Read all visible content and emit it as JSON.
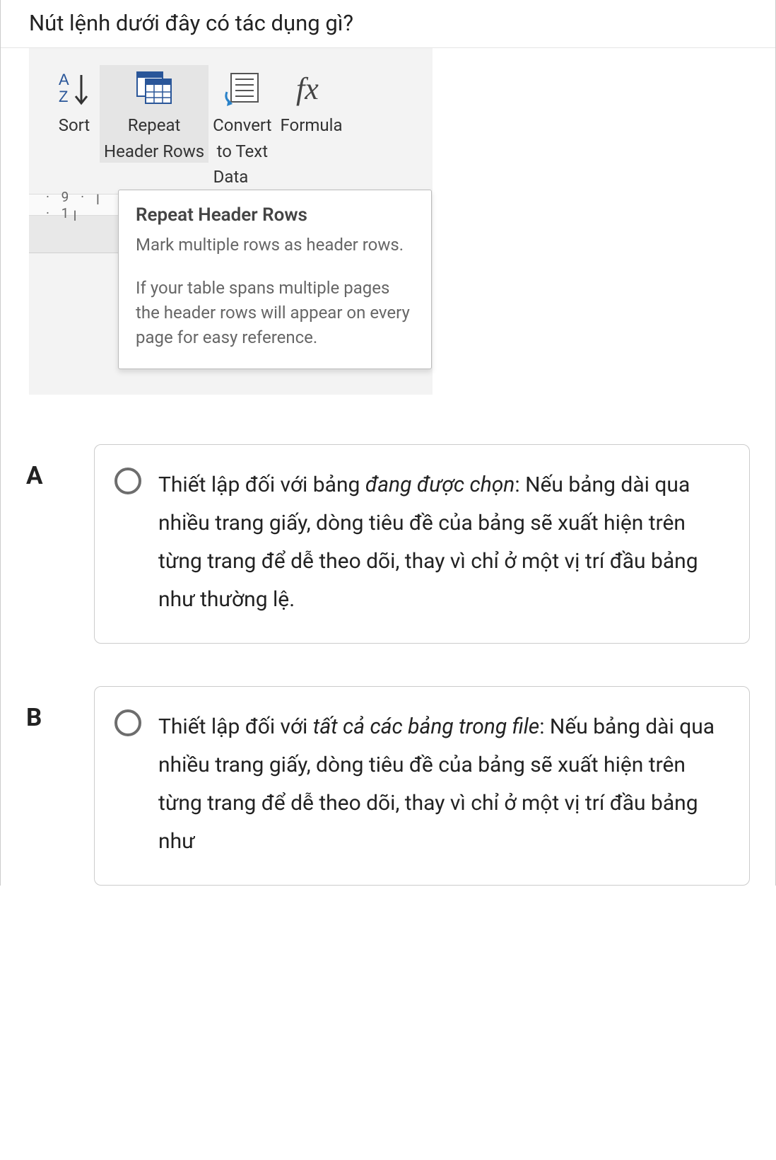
{
  "question": "Nút lệnh dưới đây có tác dụng gì?",
  "ribbon": {
    "sort": "Sort",
    "repeat1": "Repeat",
    "repeat2": "Header Rows",
    "convert1": "Convert",
    "convert2": "to Text",
    "formula": "Formula",
    "group": "Data"
  },
  "ruler": "· 9 · ꞁ · 1ꞁ",
  "tooltip": {
    "title": "Repeat Header Rows",
    "line1": "Mark multiple rows as header rows.",
    "line2": "If your table spans multiple pages the header rows will appear on every page for easy reference."
  },
  "answers": {
    "a_letter": "A",
    "a_pre": "Thiết lập đối với bảng ",
    "a_em": "đang được chọn",
    "a_post": ": Nếu bảng dài qua nhiều trang giấy, dòng tiêu đề của bảng sẽ xuất hiện trên từng trang để dễ theo dõi, thay vì chỉ ở một vị trí đầu bảng như thường lệ.",
    "b_letter": "B",
    "b_pre": "Thiết lập đối với ",
    "b_em": "tất cả các bảng trong file",
    "b_post": ": Nếu bảng dài qua nhiều trang giấy, dòng tiêu đề của bảng sẽ xuất hiện trên từng trang để dễ theo dõi, thay vì chỉ ở một vị trí đầu bảng như"
  }
}
